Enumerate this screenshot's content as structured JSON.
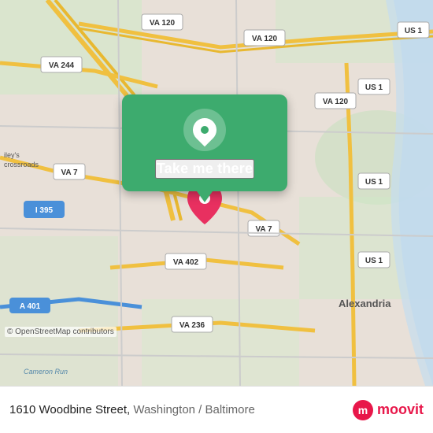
{
  "map": {
    "attribution": "© OpenStreetMap contributors",
    "background_color": "#e8e0d8"
  },
  "popup": {
    "button_label": "Take me there",
    "icon_name": "location-pin-icon"
  },
  "bottom_bar": {
    "address": "1610 Woodbine Street,",
    "city": "Washington / Baltimore",
    "logo_text": "moovit"
  }
}
